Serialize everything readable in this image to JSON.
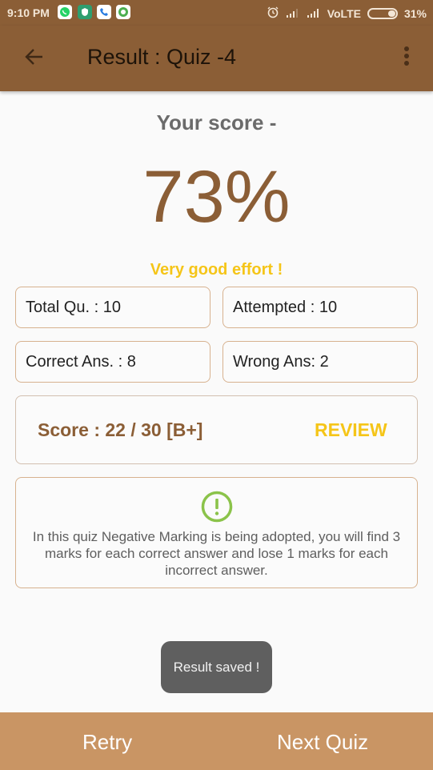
{
  "status_bar": {
    "time": "9:10 PM",
    "notification_icons": [
      "whatsapp-icon",
      "shield-app-icon",
      "phone-icon",
      "chat-app-icon"
    ],
    "network": "VoLTE",
    "battery": "31%",
    "battery_level": 0.31
  },
  "app_bar": {
    "title": "Result : Quiz -4",
    "back_icon": "arrow-left-icon",
    "menu_icon": "more-vert-icon"
  },
  "result": {
    "heading": "Your score -",
    "percentage": "73%",
    "feedback": "Very good effort !",
    "stats": [
      {
        "label": "Total Qu. : 10"
      },
      {
        "label": "Attempted  : 10"
      },
      {
        "label": "Correct Ans. : 8"
      },
      {
        "label": "Wrong Ans: 2"
      }
    ],
    "score_line": "Score : 22 / 30 [B+]",
    "review_label": "REVIEW"
  },
  "info": {
    "icon": "alert-circle-icon",
    "text": "In this quiz Negative Marking is being adopted, you will find 3 marks for each correct answer and lose 1 marks for each incorrect answer."
  },
  "toast": {
    "message": "Result saved !"
  },
  "bottom_bar": {
    "retry_label": "Retry",
    "next_label": "Next Quiz"
  },
  "colors": {
    "primary": "#8b5e36",
    "accent": "#f5c518",
    "bottom_bar": "#c99564",
    "info_icon": "#8bc34a"
  }
}
